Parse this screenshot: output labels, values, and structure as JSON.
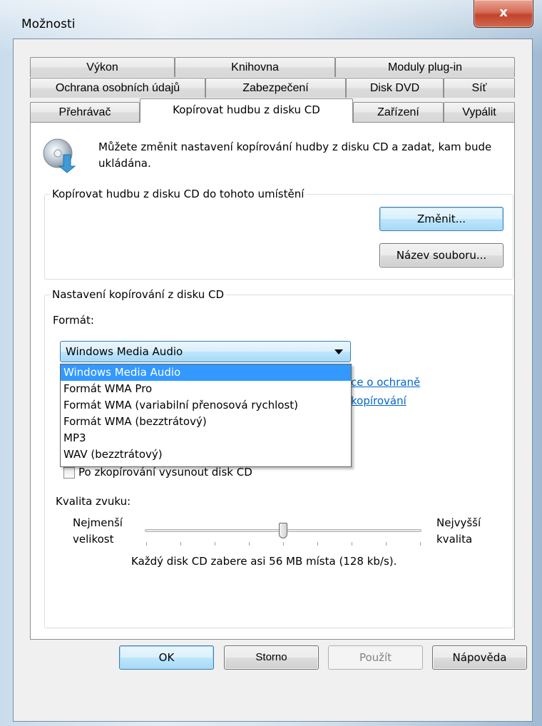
{
  "window": {
    "title": "Možnosti",
    "close_glyph": "x"
  },
  "tabs": {
    "row1": [
      "Výkon",
      "Knihovna",
      "Moduly plug-in"
    ],
    "row2": [
      "Ochrana osobních údajů",
      "Zabezpečení",
      "Disk DVD",
      "Síť"
    ],
    "row3": [
      "Přehrávač",
      "Kopírovat hudbu z disku CD",
      "Zařízení",
      "Vypálit"
    ],
    "active": "Kopírovat hudbu z disku CD"
  },
  "header": {
    "icon": "cd-rip-icon",
    "text": "Můžete změnit nastavení kopírování hudby z disku CD a zadat, kam bude ukládána."
  },
  "location": {
    "group_label": "Kopírovat hudbu z disku CD do tohoto umístění",
    "change_button": "Změnit...",
    "filename_button": "Název souboru..."
  },
  "rip_settings": {
    "group_label": "Nastavení kopírování z disku CD",
    "format_label": "Formát:",
    "format_selected": "Windows Media Audio",
    "format_options": [
      "Windows Media Audio",
      "Formát WMA Pro",
      "Formát WMA (variabilní přenosová rychlost)",
      "Formát WMA (bezztrátový)",
      "MP3",
      "WAV (bezztrátový)"
    ],
    "link_line1": "ce o ochraně",
    "link_line2": "kopírování",
    "eject_label": "Po zkopírování vysunout disk CD",
    "eject_checked": false,
    "quality_label": "Kvalita zvuku:",
    "quality_min_line1": "Nejmenší",
    "quality_min_line2": "velikost",
    "quality_max_line1": "Nejvyšší",
    "quality_max_line2": "kvalita",
    "quality_level_fraction": 0.5,
    "quality_note": "Každý disk CD zabere asi 56 MB místa (128 kb/s)."
  },
  "footer": {
    "ok": "OK",
    "cancel": "Storno",
    "apply": "Použít",
    "help": "Nápověda"
  }
}
